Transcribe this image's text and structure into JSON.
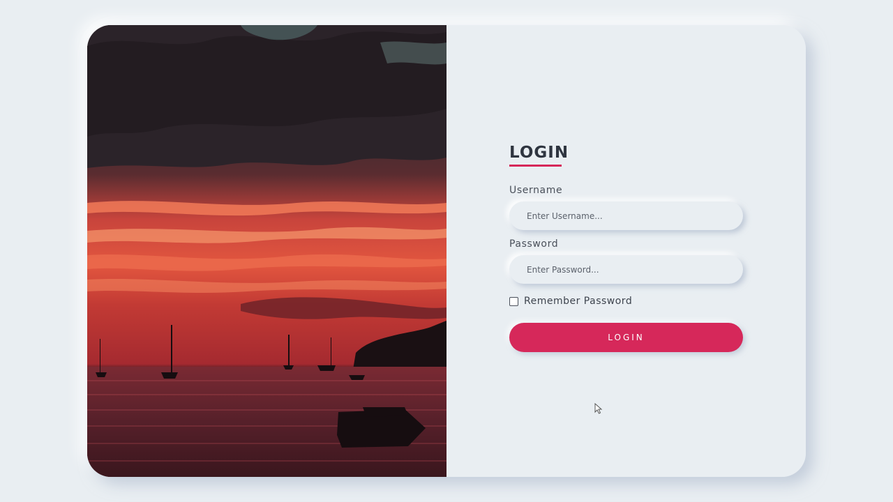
{
  "hero": {
    "image_icon": "sunset-sea-photo"
  },
  "login": {
    "title": "LOGIN",
    "username_label": "Username",
    "username_placeholder": "Enter Username...",
    "password_label": "Password",
    "password_placeholder": "Enter Password...",
    "remember_label": "Remember Password",
    "remember_checked": false,
    "button_label": "LOGIN"
  },
  "colors": {
    "background": "#e9eef2",
    "accent": "#d6285a",
    "text": "#2f3540"
  }
}
